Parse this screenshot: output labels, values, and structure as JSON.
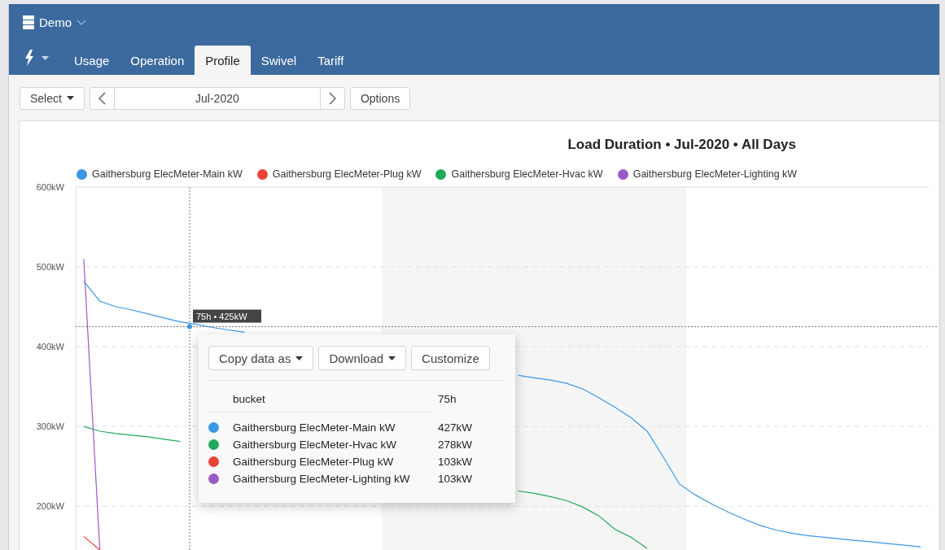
{
  "header": {
    "workspace": "Demo"
  },
  "tabs": [
    {
      "label": "Usage",
      "selected": false
    },
    {
      "label": "Operation",
      "selected": false
    },
    {
      "label": "Profile",
      "selected": true
    },
    {
      "label": "Swivel",
      "selected": false
    },
    {
      "label": "Tariff",
      "selected": false
    }
  ],
  "toolbar": {
    "select": "Select",
    "date": "Jul-2020",
    "options": "Options"
  },
  "chart": {
    "chart_data": {
      "type": "line",
      "title": "Load Duration • Jul-2020 • All Days",
      "ylim": [
        144,
        600
      ],
      "grid": true,
      "categories": [
        null,
        null,
        null,
        null,
        null,
        null,
        null,
        null,
        null,
        null,
        null,
        null,
        null,
        null,
        null,
        null,
        null,
        null,
        null,
        null,
        null,
        null,
        null,
        null,
        null,
        null,
        null,
        null,
        null,
        null,
        null,
        null,
        null,
        null,
        null,
        null,
        null,
        null,
        null,
        null,
        null,
        null,
        null,
        null,
        null,
        null,
        null,
        null,
        null,
        null,
        null,
        null,
        null
      ],
      "yticks": [
        {
          "value": 600,
          "label": "600kW"
        },
        {
          "value": 500,
          "label": "500kW"
        },
        {
          "value": 400,
          "label": "400kW"
        },
        {
          "value": 300,
          "label": "300kW"
        },
        {
          "value": 200,
          "label": "200kW"
        }
      ],
      "ref_lines": [
        {
          "axis": "y",
          "value": 425
        }
      ],
      "annotations": [
        {
          "text": "75h • 425kW",
          "y": 425
        }
      ],
      "series": [
        {
          "name": "Gaithersburg ElecMeter-Main kW",
          "color": "#3b97e3",
          "values": [
            482,
            457,
            450,
            446,
            441,
            436,
            431,
            428,
            424,
            421,
            418,
            null,
            null,
            null,
            null,
            null,
            null,
            null,
            null,
            null,
            null,
            null,
            null,
            null,
            null,
            null,
            null,
            364,
            361,
            358,
            354,
            347,
            336,
            324,
            311,
            294,
            262,
            228,
            214,
            203,
            193,
            184,
            176,
            170,
            166,
            163,
            161,
            159,
            157,
            155,
            153,
            151,
            149
          ]
        },
        {
          "name": "Gaithersburg ElecMeter-Plug kW",
          "color": "#ea4335",
          "values": [
            162,
            145,
            null,
            null,
            null,
            null,
            null,
            null,
            null,
            null,
            null,
            null,
            null,
            null,
            null,
            null,
            null,
            null,
            null,
            null,
            null,
            null,
            null,
            null,
            null,
            null,
            null,
            null,
            null,
            null,
            null,
            null,
            null,
            null,
            null,
            null,
            null,
            null,
            null,
            null,
            null,
            null,
            null,
            null,
            null,
            null,
            null,
            null,
            null,
            null,
            null,
            null,
            null
          ]
        },
        {
          "name": "Gaithersburg ElecMeter-Hvac kW",
          "color": "#1faa5a",
          "values": [
            300,
            294,
            291,
            289,
            287,
            284,
            281,
            null,
            null,
            null,
            null,
            null,
            null,
            null,
            null,
            null,
            null,
            null,
            null,
            null,
            null,
            null,
            null,
            null,
            null,
            null,
            null,
            219,
            216,
            212,
            207,
            199,
            188,
            171,
            161,
            147,
            null,
            null,
            null,
            null,
            null,
            null,
            null,
            null,
            null,
            null,
            null,
            null,
            null,
            null,
            null,
            null,
            null
          ]
        },
        {
          "name": "Gaithersburg ElecMeter-Lighting kW",
          "color": "#9b59c6",
          "values": [
            510,
            144,
            null,
            null,
            null,
            null,
            null,
            null,
            null,
            null,
            null,
            null,
            null,
            null,
            null,
            null,
            null,
            null,
            null,
            null,
            null,
            null,
            null,
            null,
            null,
            null,
            null,
            null,
            null,
            null,
            null,
            null,
            null,
            null,
            null,
            null,
            null,
            null,
            null,
            null,
            null,
            null,
            null,
            null,
            null,
            null,
            null,
            null,
            null,
            null,
            null,
            null,
            null
          ]
        }
      ]
    }
  },
  "popup": {
    "buttons": [
      {
        "label": "Copy data as",
        "dropdown": true
      },
      {
        "label": "Download",
        "dropdown": true
      },
      {
        "label": "Customize",
        "dropdown": false
      }
    ],
    "header": {
      "label": "bucket",
      "value": "75h"
    },
    "rows": [
      {
        "name": "Gaithersburg ElecMeter-Main kW",
        "value": "427kW",
        "color": "#3b97e3"
      },
      {
        "name": "Gaithersburg ElecMeter-Hvac kW",
        "value": "278kW",
        "color": "#1faa5a"
      },
      {
        "name": "Gaithersburg ElecMeter-Plug kW",
        "value": "103kW",
        "color": "#ea4335"
      },
      {
        "name": "Gaithersburg ElecMeter-Lighting kW",
        "value": "103kW",
        "color": "#9b59c6"
      }
    ]
  }
}
